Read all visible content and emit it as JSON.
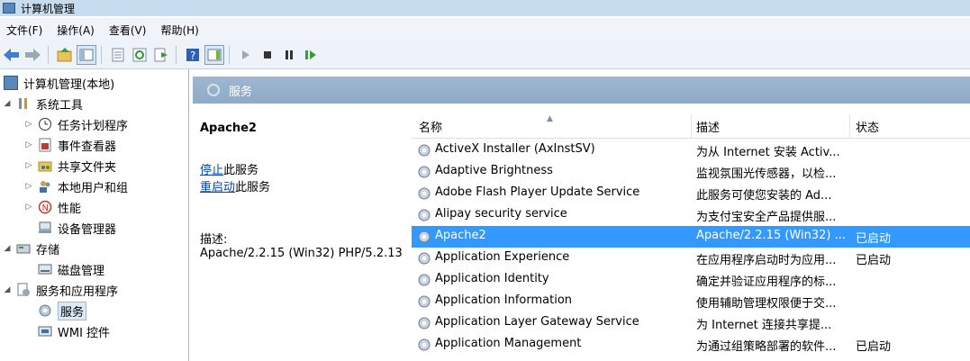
{
  "window": {
    "title": "计算机管理"
  },
  "menu": [
    "文件(F)",
    "操作(A)",
    "查看(V)",
    "帮助(H)"
  ],
  "toolbar": [
    "back-arrow-icon",
    "forward-arrow-icon",
    "up-folder-icon",
    "show-hide-tree-icon",
    "properties-icon",
    "refresh-icon",
    "export-icon",
    "help-icon",
    "console-icon",
    "start-icon",
    "stop-icon",
    "pause-icon",
    "restart-icon"
  ],
  "tree": {
    "root": "计算机管理(本地)",
    "system_tools": "系统工具",
    "task_scheduler": "任务计划程序",
    "event_viewer": "事件查看器",
    "shared_folders": "共享文件夹",
    "local_users": "本地用户和组",
    "performance": "性能",
    "device_manager": "设备管理器",
    "storage": "存储",
    "disk_management": "磁盘管理",
    "services_apps": "服务和应用程序",
    "services": "服务",
    "wmi": "WMI 控件"
  },
  "panel": {
    "title": "服务"
  },
  "details": {
    "service_name": "Apache2",
    "stop_link": "停止",
    "stop_suffix": "此服务",
    "restart_link": "重启动",
    "restart_suffix": "此服务",
    "desc_label": "描述:",
    "desc_value": "Apache/2.2.15 (Win32) PHP/5.2.13"
  },
  "grid": {
    "headers": {
      "name": "名称",
      "description": "描述",
      "status": "状态"
    },
    "rows": [
      {
        "name": "ActiveX Installer (AxInstSV)",
        "description": "为从 Internet 安装 Activ...",
        "status": ""
      },
      {
        "name": "Adaptive Brightness",
        "description": "监视氛围光传感器，以检...",
        "status": ""
      },
      {
        "name": "Adobe Flash Player Update Service",
        "description": "此服务可使您安装的 Ad...",
        "status": ""
      },
      {
        "name": "Alipay security service",
        "description": "为支付宝安全产品提供服...",
        "status": ""
      },
      {
        "name": "Apache2",
        "description": "Apache/2.2.15 (Win32) ...",
        "status": "已启动"
      },
      {
        "name": "Application Experience",
        "description": "在应用程序启动时为应用...",
        "status": "已启动"
      },
      {
        "name": "Application Identity",
        "description": "确定并验证应用程序的标...",
        "status": ""
      },
      {
        "name": "Application Information",
        "description": "使用辅助管理权限便于交...",
        "status": ""
      },
      {
        "name": "Application Layer Gateway Service",
        "description": "为 Internet 连接共享提...",
        "status": ""
      },
      {
        "name": "Application Management",
        "description": "为通过组策略部署的软件...",
        "status": "已启动"
      }
    ],
    "selected_index": 4
  },
  "colors": {
    "selection": "#3399ff",
    "header_bar": "#8eaac6"
  }
}
